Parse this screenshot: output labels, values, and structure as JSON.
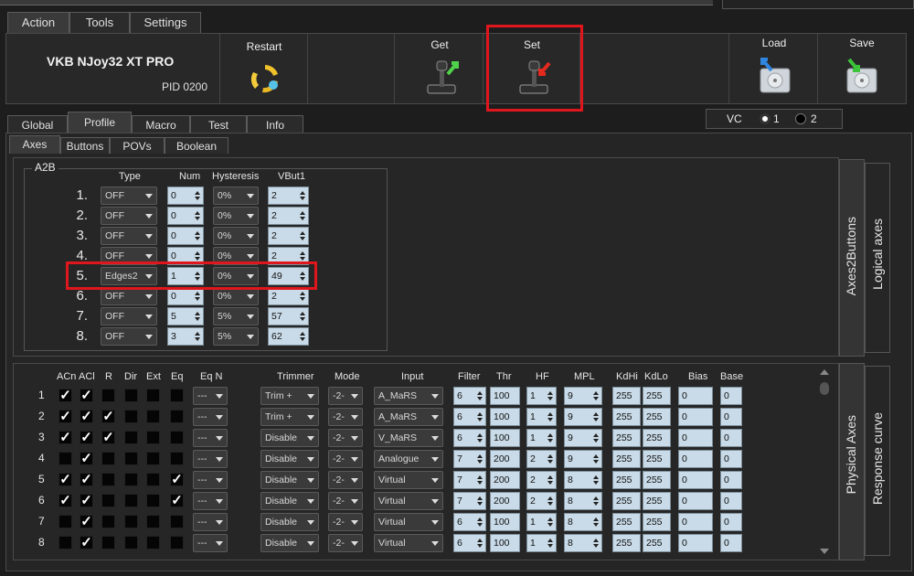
{
  "menu_tabs": [
    "Action",
    "Tools",
    "Settings"
  ],
  "device": {
    "name": "VKB NJoy32 XT PRO",
    "pid": "PID 0200"
  },
  "toolbar": {
    "restart": "Restart",
    "get": "Get",
    "set": "Set",
    "load": "Load",
    "save": "Save"
  },
  "profile_tabs": [
    "Global",
    "Profile",
    "Macro",
    "Test",
    "Info"
  ],
  "vc": {
    "label": "VC",
    "opt1": "1",
    "opt2": "2"
  },
  "sub_tabs": [
    "Axes",
    "Buttons",
    "POVs",
    "Boolean"
  ],
  "a2b": {
    "group_label": "A2B",
    "headers": [
      "Type",
      "Num",
      "Hysteresis",
      "VBut1"
    ],
    "rows": [
      {
        "n": "1.",
        "type": "OFF",
        "num": "0",
        "hyst": "0%",
        "vbut": "2"
      },
      {
        "n": "2.",
        "type": "OFF",
        "num": "0",
        "hyst": "0%",
        "vbut": "2"
      },
      {
        "n": "3.",
        "type": "OFF",
        "num": "0",
        "hyst": "0%",
        "vbut": "2"
      },
      {
        "n": "4.",
        "type": "OFF",
        "num": "0",
        "hyst": "0%",
        "vbut": "2"
      },
      {
        "n": "5.",
        "type": "Edges2",
        "num": "1",
        "hyst": "0%",
        "vbut": "49"
      },
      {
        "n": "6.",
        "type": "OFF",
        "num": "0",
        "hyst": "0%",
        "vbut": "2"
      },
      {
        "n": "7.",
        "type": "OFF",
        "num": "5",
        "hyst": "5%",
        "vbut": "57"
      },
      {
        "n": "8.",
        "type": "OFF",
        "num": "3",
        "hyst": "5%",
        "vbut": "62"
      }
    ]
  },
  "side_tabs_top": {
    "a": "Axes2Buttons",
    "b": "Logical axes"
  },
  "side_tabs_bottom": {
    "a": "Physical Axes",
    "b": "Response curve"
  },
  "phys": {
    "headers": {
      "acn": "ACn",
      "acl": "ACl",
      "r": "R",
      "dir": "Dir",
      "ext": "Ext",
      "eq": "Eq",
      "eqn": "Eq N",
      "trimmer": "Trimmer",
      "mode": "Mode",
      "input": "Input",
      "filter": "Filter",
      "thr": "Thr",
      "hf": "HF",
      "mpl": "MPL",
      "kdhi": "KdHi",
      "kdlo": "KdLo",
      "bias": "Bias",
      "base": "Base"
    },
    "rows": [
      {
        "n": "1",
        "acn": true,
        "acl": true,
        "r": false,
        "dir": false,
        "ext": false,
        "eq": false,
        "eqn": "---",
        "trimmer": "Trim +",
        "mode": "-2-",
        "input": "A_MaRS",
        "filter": "6",
        "thr": "100",
        "hf": "1",
        "mpl": "9",
        "kdhi": "255",
        "kdlo": "255",
        "bias": "0",
        "base": "0"
      },
      {
        "n": "2",
        "acn": true,
        "acl": true,
        "r": true,
        "dir": false,
        "ext": false,
        "eq": false,
        "eqn": "---",
        "trimmer": "Trim +",
        "mode": "-2-",
        "input": "A_MaRS",
        "filter": "6",
        "thr": "100",
        "hf": "1",
        "mpl": "9",
        "kdhi": "255",
        "kdlo": "255",
        "bias": "0",
        "base": "0"
      },
      {
        "n": "3",
        "acn": true,
        "acl": true,
        "r": true,
        "dir": false,
        "ext": false,
        "eq": false,
        "eqn": "---",
        "trimmer": "Disable",
        "mode": "-2-",
        "input": "V_MaRS",
        "filter": "6",
        "thr": "100",
        "hf": "1",
        "mpl": "9",
        "kdhi": "255",
        "kdlo": "255",
        "bias": "0",
        "base": "0"
      },
      {
        "n": "4",
        "acn": false,
        "acl": true,
        "r": false,
        "dir": false,
        "ext": false,
        "eq": false,
        "eqn": "---",
        "trimmer": "Disable",
        "mode": "-2-",
        "input": "Analogue",
        "filter": "7",
        "thr": "200",
        "hf": "2",
        "mpl": "9",
        "kdhi": "255",
        "kdlo": "255",
        "bias": "0",
        "base": "0"
      },
      {
        "n": "5",
        "acn": true,
        "acl": true,
        "r": false,
        "dir": false,
        "ext": false,
        "eq": true,
        "eqn": "---",
        "trimmer": "Disable",
        "mode": "-2-",
        "input": "Virtual",
        "filter": "7",
        "thr": "200",
        "hf": "2",
        "mpl": "8",
        "kdhi": "255",
        "kdlo": "255",
        "bias": "0",
        "base": "0"
      },
      {
        "n": "6",
        "acn": true,
        "acl": true,
        "r": false,
        "dir": false,
        "ext": false,
        "eq": true,
        "eqn": "---",
        "trimmer": "Disable",
        "mode": "-2-",
        "input": "Virtual",
        "filter": "7",
        "thr": "200",
        "hf": "2",
        "mpl": "8",
        "kdhi": "255",
        "kdlo": "255",
        "bias": "0",
        "base": "0"
      },
      {
        "n": "7",
        "acn": false,
        "acl": true,
        "r": false,
        "dir": false,
        "ext": false,
        "eq": false,
        "eqn": "---",
        "trimmer": "Disable",
        "mode": "-2-",
        "input": "Virtual",
        "filter": "6",
        "thr": "100",
        "hf": "1",
        "mpl": "8",
        "kdhi": "255",
        "kdlo": "255",
        "bias": "0",
        "base": "0"
      },
      {
        "n": "8",
        "acn": false,
        "acl": true,
        "r": false,
        "dir": false,
        "ext": false,
        "eq": false,
        "eqn": "---",
        "trimmer": "Disable",
        "mode": "-2-",
        "input": "Virtual",
        "filter": "6",
        "thr": "100",
        "hf": "1",
        "mpl": "8",
        "kdhi": "255",
        "kdlo": "255",
        "bias": "0",
        "base": "0"
      }
    ]
  },
  "colors": {
    "highlight": "#e0161d",
    "field": "#c9dbe8",
    "bg": "#1d1d1d"
  }
}
